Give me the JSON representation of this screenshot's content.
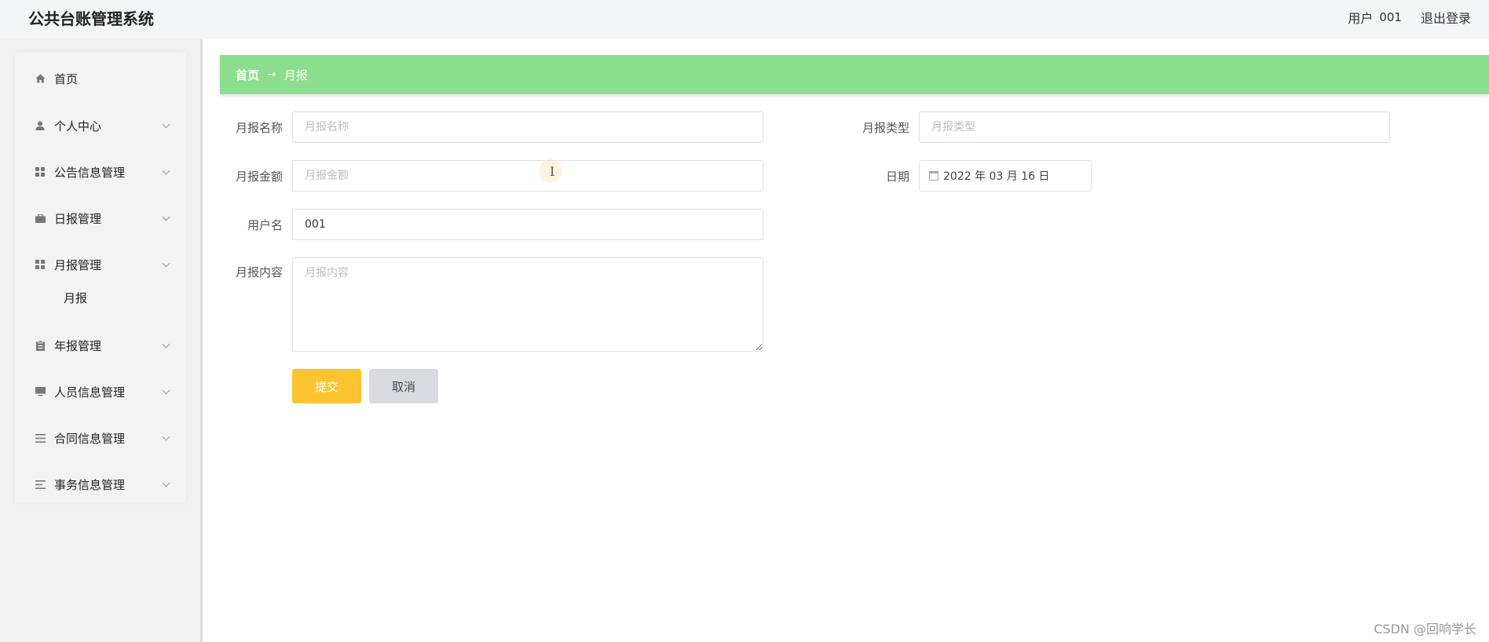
{
  "header": {
    "title": "公共台账管理系统",
    "user_label": "用户",
    "user_id": "001",
    "logout": "退出登录"
  },
  "sidebar": {
    "items": [
      {
        "label": "首页",
        "icon": "home-icon"
      },
      {
        "label": "个人中心",
        "icon": "user-icon"
      },
      {
        "label": "公告信息管理",
        "icon": "grid-icon"
      },
      {
        "label": "日报管理",
        "icon": "briefcase-icon"
      },
      {
        "label": "月报管理",
        "icon": "grid-icon"
      },
      {
        "label": "年报管理",
        "icon": "clipboard-icon"
      },
      {
        "label": "人员信息管理",
        "icon": "monitor-icon"
      },
      {
        "label": "合同信息管理",
        "icon": "list-icon"
      },
      {
        "label": "事务信息管理",
        "icon": "list-icon"
      }
    ],
    "submenu": {
      "label": "月报"
    }
  },
  "breadcrumb": {
    "home": "首页",
    "separator": "→",
    "current": "月报"
  },
  "form": {
    "name": {
      "label": "月报名称",
      "placeholder": "月报名称",
      "value": ""
    },
    "type": {
      "label": "月报类型",
      "placeholder": "月报类型",
      "value": ""
    },
    "amount": {
      "label": "月报金额",
      "placeholder": "月报金额",
      "value": ""
    },
    "date": {
      "label": "日期",
      "value": "2022 年 03 月 16 日"
    },
    "username": {
      "label": "用户名",
      "value": "001"
    },
    "content": {
      "label": "月报内容",
      "placeholder": "月报内容",
      "value": ""
    },
    "submit_label": "提交",
    "cancel_label": "取消"
  },
  "watermark": "CSDN @回响学长",
  "colors": {
    "breadcrumb_bg": "#8ade8c",
    "submit_bg": "#fcc52f",
    "cancel_bg": "#d9dbdf"
  }
}
